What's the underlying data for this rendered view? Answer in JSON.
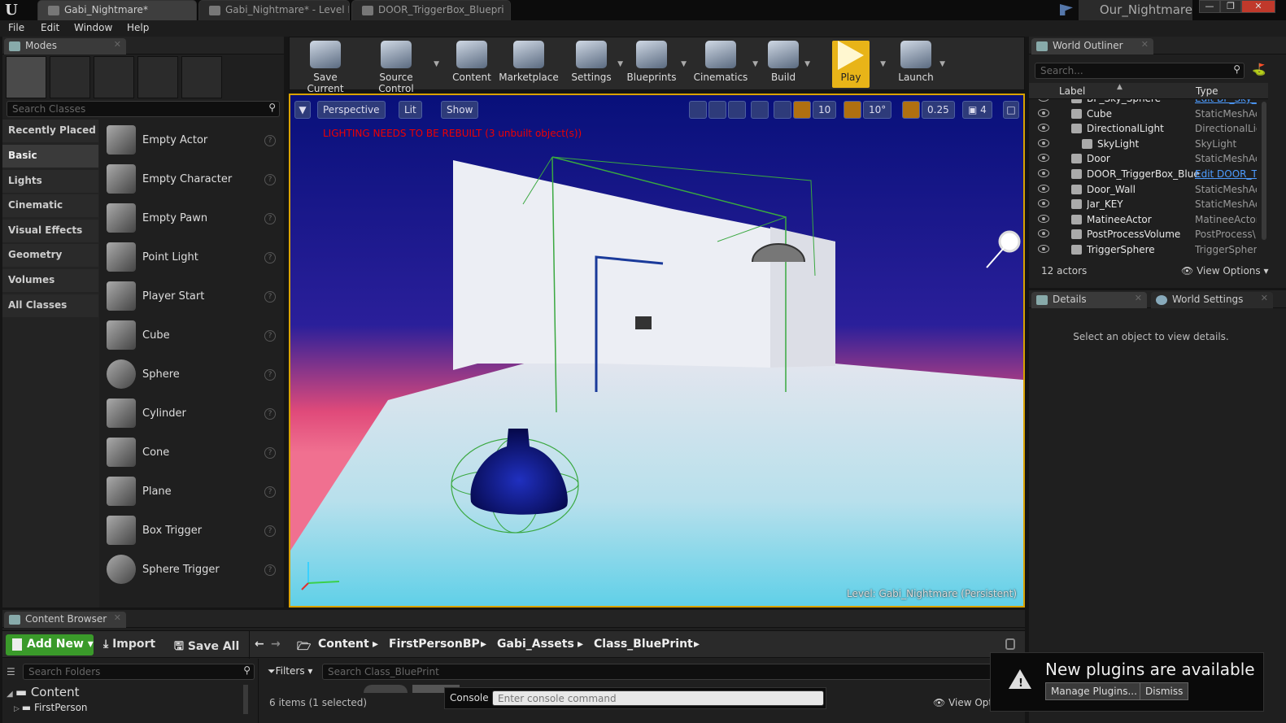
{
  "window": {
    "tabs": [
      "Gabi_Nightmare*",
      "Gabi_Nightmare* - Level B",
      "DOOR_TriggerBox_Bluepri"
    ],
    "project_name": "Our_Nightmare",
    "controls": [
      "—",
      "❐",
      "✕"
    ]
  },
  "menu": [
    "File",
    "Edit",
    "Window",
    "Help"
  ],
  "modes": {
    "tab_label": "Modes",
    "search_placeholder": "Search Classes",
    "categories": [
      "Recently Placed",
      "Basic",
      "Lights",
      "Cinematic",
      "Visual Effects",
      "Geometry",
      "Volumes",
      "All Classes"
    ],
    "selected_category": "Basic",
    "items": [
      "Empty Actor",
      "Empty Character",
      "Empty Pawn",
      "Point Light",
      "Player Start",
      "Cube",
      "Sphere",
      "Cylinder",
      "Cone",
      "Plane",
      "Box Trigger",
      "Sphere Trigger"
    ]
  },
  "toolbar": {
    "buttons": [
      "Save Current",
      "Source Control",
      "Content",
      "Marketplace",
      "Settings",
      "Blueprints",
      "Cinematics",
      "Build",
      "Play",
      "Launch"
    ]
  },
  "viewport": {
    "perspective_label": "Perspective",
    "lit_label": "Lit",
    "show_label": "Show",
    "grid_snap": "10",
    "rotation_snap": "10°",
    "scale_snap": "0.25",
    "camera_speed": "4",
    "warning": "LIGHTING NEEDS TO BE REBUILT (3 unbuilt object(s))",
    "level_label": "Level:  Gabi_Nightmare (Persistent)"
  },
  "outliner": {
    "tab_label": "World Outliner",
    "search_placeholder": "Search...",
    "col_label": "Label",
    "col_type": "Type",
    "rows": [
      {
        "label": "BP_Sky_Sphere",
        "type": "Edit BP_Sky_",
        "type_link": true,
        "indent": 1
      },
      {
        "label": "Cube",
        "type": "StaticMeshAc",
        "type_link": false,
        "indent": 1
      },
      {
        "label": "DirectionalLight",
        "type": "DirectionalLig",
        "type_link": false,
        "indent": 1
      },
      {
        "label": "SkyLight",
        "type": "SkyLight",
        "type_link": false,
        "indent": 2
      },
      {
        "label": "Door",
        "type": "StaticMeshAc",
        "type_link": false,
        "indent": 1
      },
      {
        "label": "DOOR_TriggerBox_Blue",
        "type": "Edit DOOR_T",
        "type_link": true,
        "indent": 1
      },
      {
        "label": "Door_Wall",
        "type": "StaticMeshAc",
        "type_link": false,
        "indent": 1
      },
      {
        "label": "Jar_KEY",
        "type": "StaticMeshAc",
        "type_link": false,
        "indent": 1
      },
      {
        "label": "MatineeActor",
        "type": "MatineeActor",
        "type_link": false,
        "indent": 1
      },
      {
        "label": "PostProcessVolume",
        "type": "PostProcess\\",
        "type_link": false,
        "indent": 1
      },
      {
        "label": "TriggerSphere",
        "type": "TriggerSpher",
        "type_link": false,
        "indent": 1
      }
    ],
    "actor_count": "12 actors",
    "view_options": "View Options"
  },
  "details": {
    "tab_details": "Details",
    "tab_world_settings": "World Settings",
    "empty_message": "Select an object to view details."
  },
  "content_browser": {
    "tab_label": "Content Browser",
    "add_new": "Add New",
    "import": "Import",
    "save_all": "Save All",
    "breadcrumb": [
      "Content",
      "FirstPersonBP",
      "Gabi_Assets",
      "Class_BluePrint"
    ],
    "search_folders_placeholder": "Search Folders",
    "filters": "Filters",
    "search_assets_placeholder": "Search Class_BluePrint",
    "tree": [
      "Content",
      "FirstPerson"
    ],
    "item_count": "6 items (1 selected)",
    "console_label": "Console",
    "console_placeholder": "Enter console command",
    "view_options": "View Opti"
  },
  "notification": {
    "title": "New plugins are available",
    "manage": "Manage Plugins...",
    "dismiss": "Dismiss"
  },
  "colors": {
    "accent_play": "#e8b418",
    "viewport_border": "#d8a200",
    "warning": "#ee0000",
    "add_new": "#3a9a2a",
    "link": "#4d9cff"
  }
}
